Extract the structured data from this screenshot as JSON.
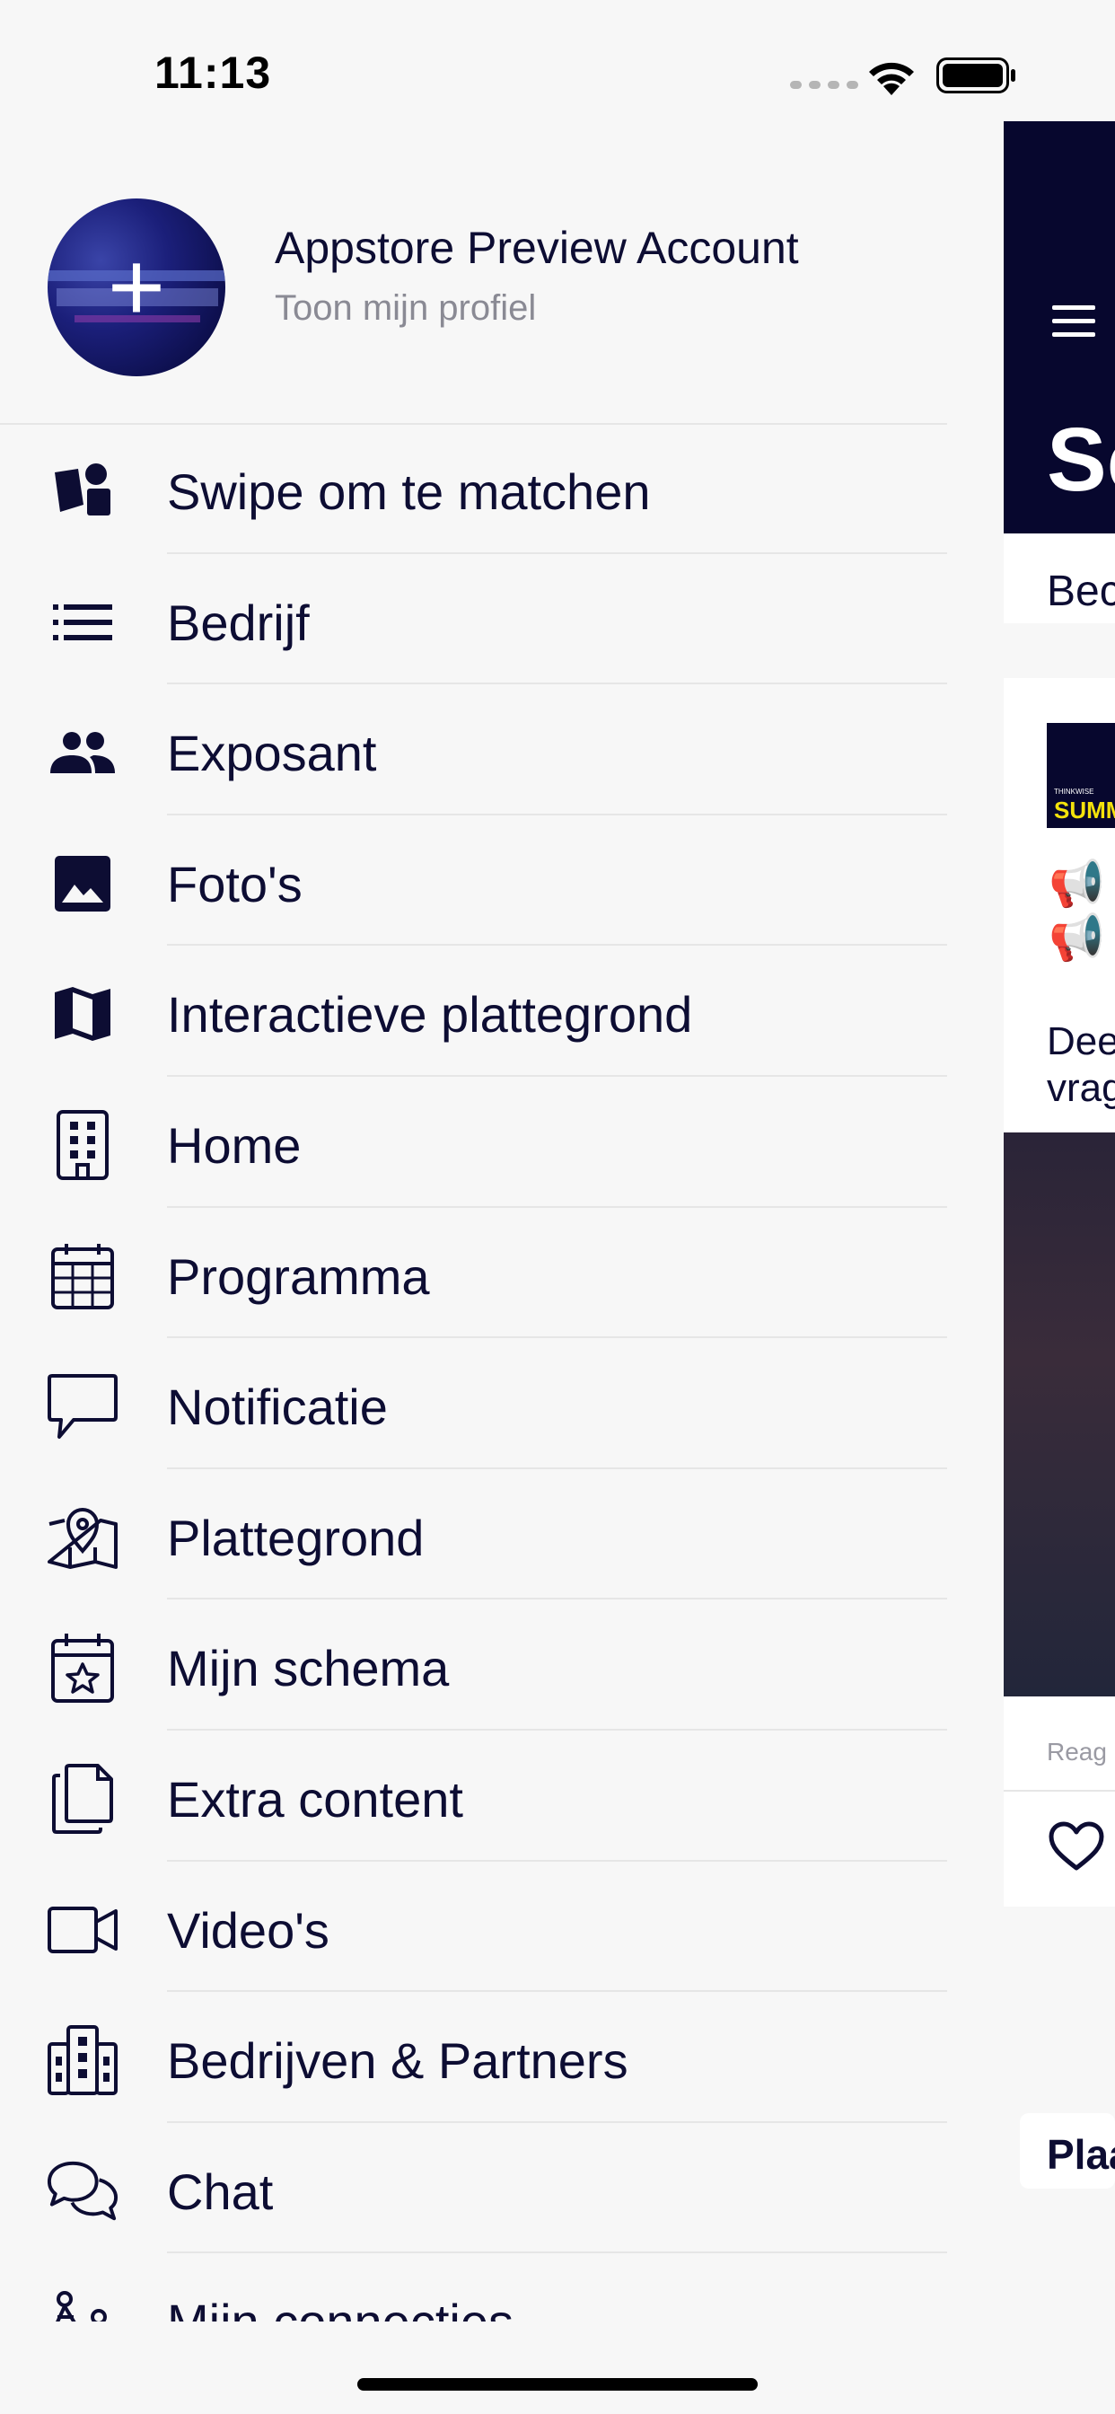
{
  "status_bar": {
    "time": "11:13"
  },
  "profile": {
    "name": "Appstore Preview Account",
    "subtitle": "Toon mijn profiel"
  },
  "menu": {
    "items": [
      {
        "label": "Swipe om te matchen",
        "icon": "swipe-match-icon"
      },
      {
        "label": "Bedrijf",
        "icon": "list-icon"
      },
      {
        "label": "Exposant",
        "icon": "people-icon"
      },
      {
        "label": "Foto's",
        "icon": "image-icon"
      },
      {
        "label": "Interactieve plattegrond",
        "icon": "map-icon"
      },
      {
        "label": "Home",
        "icon": "building-icon"
      },
      {
        "label": "Programma",
        "icon": "calendar-grid-icon"
      },
      {
        "label": "Notificatie",
        "icon": "chat-bubble-icon"
      },
      {
        "label": "Plattegrond",
        "icon": "map-pin-icon"
      },
      {
        "label": "Mijn schema",
        "icon": "calendar-star-icon"
      },
      {
        "label": "Extra content",
        "icon": "files-icon"
      },
      {
        "label": "Video's",
        "icon": "video-icon"
      },
      {
        "label": "Bedrijven & Partners",
        "icon": "buildings-icon"
      },
      {
        "label": "Chat",
        "icon": "chat-bubbles-icon"
      },
      {
        "label": "Mijn connecties",
        "icon": "connections-icon"
      }
    ]
  },
  "background": {
    "header_title": "Sc",
    "tab_text": "Bec",
    "thumb_small": "THINKWISE",
    "thumb_big": "SUMM",
    "card_line1": "Dee",
    "card_line2": "vrag",
    "react_text": "Reag",
    "comment_text": "Plaa"
  },
  "colors": {
    "text": "#0d0d33",
    "muted": "#8a8a94",
    "header_bg": "#07072e",
    "drawer_bg": "#f7f7f7"
  }
}
